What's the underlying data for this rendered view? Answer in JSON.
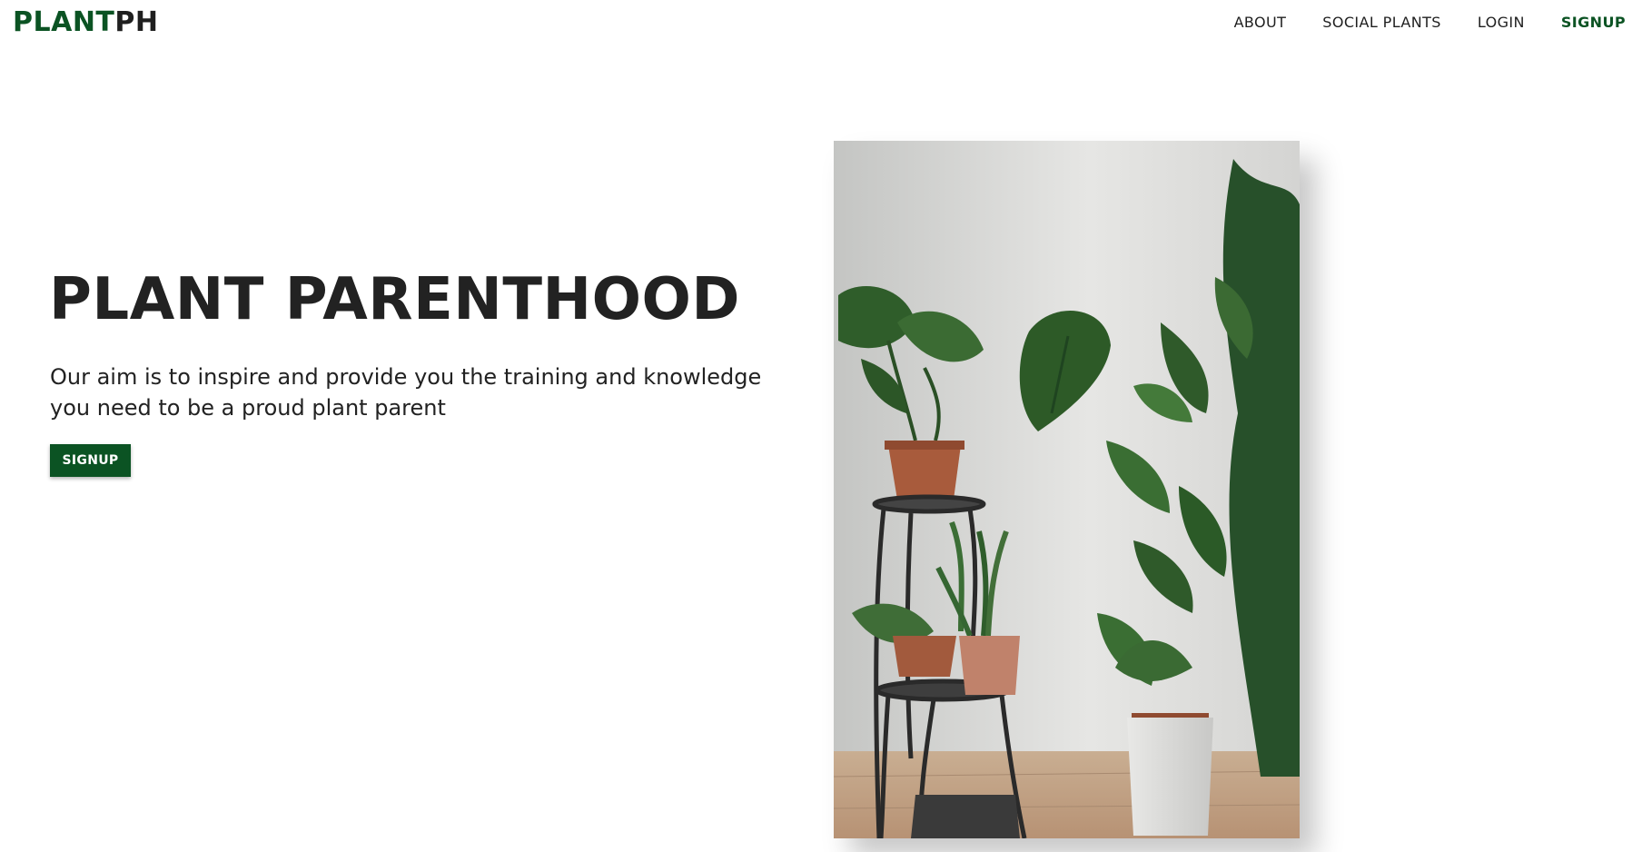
{
  "header": {
    "brand_part1": "PLANT",
    "brand_part2": "PH",
    "nav": [
      {
        "label": "ABOUT"
      },
      {
        "label": "SOCIAL PLANTS"
      },
      {
        "label": "LOGIN"
      },
      {
        "label": "SIGNUP"
      }
    ]
  },
  "hero": {
    "title": "PLANT PARENTHOOD",
    "description": "Our aim is to inspire and provide you the training and knowledge you need to be a proud plant parent",
    "signup_label": "SIGNUP",
    "image_icon": "houseplants-photo"
  },
  "colors": {
    "brand_green": "#0b5323",
    "text": "#222222",
    "background": "#ffffff"
  }
}
